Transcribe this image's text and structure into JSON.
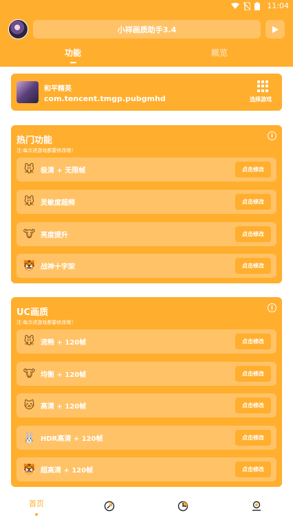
{
  "statusbar": {
    "time": "11:04"
  },
  "header": {
    "title": "小祥画质助手3.4",
    "tabs": [
      {
        "label": "功能",
        "active": true
      },
      {
        "label": "概览",
        "active": false
      }
    ]
  },
  "game": {
    "name": "和平精英",
    "package": "com.tencent.tmgp.pubgmhd",
    "select_label": "选择游戏"
  },
  "hot": {
    "title": "热门功能",
    "note": "注:每次进游戏都要修改哦！",
    "items": [
      {
        "label": "极清 + 无限帧",
        "button": "点击修改",
        "icon": "mouse-face-icon",
        "glyph": "🐭"
      },
      {
        "label": "灵敏度超频",
        "button": "点击修改",
        "icon": "mouse-face-icon",
        "glyph": "🐭"
      },
      {
        "label": "亮度提升",
        "button": "点击修改",
        "icon": "cow-face-icon",
        "glyph": "🐮"
      },
      {
        "label": "战神十字架",
        "button": "点击修改",
        "icon": "tiger-face-icon",
        "glyph": "🐯"
      }
    ]
  },
  "uc": {
    "title": "UC画质",
    "note": "注:每次进游戏都要修改哦！",
    "items": [
      {
        "label": "流畅 + 120帧",
        "button": "点击修改",
        "icon": "mouse-face-icon",
        "glyph": "🐭"
      },
      {
        "label": "均衡 + 120帧",
        "button": "点击修改",
        "icon": "cow-face-icon",
        "glyph": "🐮"
      },
      {
        "label": "高清 + 120帧",
        "button": "点击修改",
        "icon": "cat-face-icon",
        "glyph": "🐱"
      },
      {
        "label": "HDR高清 + 120帧",
        "button": "点击修改",
        "icon": "rabbit-face-icon",
        "glyph": "🐰"
      },
      {
        "label": "超高清 + 120帧",
        "button": "点击修改",
        "icon": "tiger-face-icon",
        "glyph": "🐯"
      }
    ]
  },
  "bottomnav": {
    "home_label": "首页",
    "items": [
      "home",
      "rocket-icon",
      "pie-chart-icon",
      "user-icon"
    ]
  },
  "colors": {
    "primary": "#FFAE2E",
    "row": "#FFC266"
  }
}
